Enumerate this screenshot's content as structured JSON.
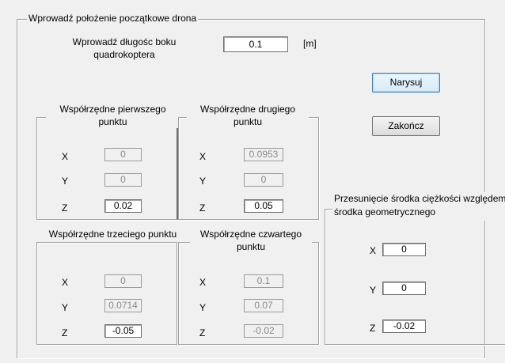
{
  "main_panel": {
    "title": "Wprowadź położenie początkowe drona",
    "side_label": "Wprowadź długośc boku quadrokoptera",
    "side_value": "0.1",
    "side_unit": "[m]"
  },
  "buttons": {
    "draw_label": "Narysuj",
    "close_label": "Zakończ"
  },
  "points": [
    {
      "title": "Współrzędne pierwszego punktu",
      "x_label": "X",
      "y_label": "Y",
      "z_label": "Z",
      "x": "0",
      "y": "0",
      "z": "0.02"
    },
    {
      "title": "Współrzędne drugiego punktu",
      "x_label": "X",
      "y_label": "Y",
      "z_label": "Z",
      "x": "0.0953",
      "y": "0",
      "z": "0.05"
    },
    {
      "title": "Współrzędne trzeciego punktu",
      "x_label": "X",
      "y_label": "Y",
      "z_label": "Z",
      "x": "0",
      "y": "0.0714",
      "z": "-0.05"
    },
    {
      "title": "Współrzędne czwartego punktu",
      "x_label": "X",
      "y_label": "Y",
      "z_label": "Z",
      "x": "0.1",
      "y": "0.07",
      "z": "-0.02"
    }
  ],
  "cog_offset": {
    "title": "Przesunięcie środka ciężkości względem środka geometrycznego",
    "x_label": "X",
    "y_label": "Y",
    "z_label": "Z",
    "x": "0",
    "y": "0",
    "z": "-0.02"
  }
}
